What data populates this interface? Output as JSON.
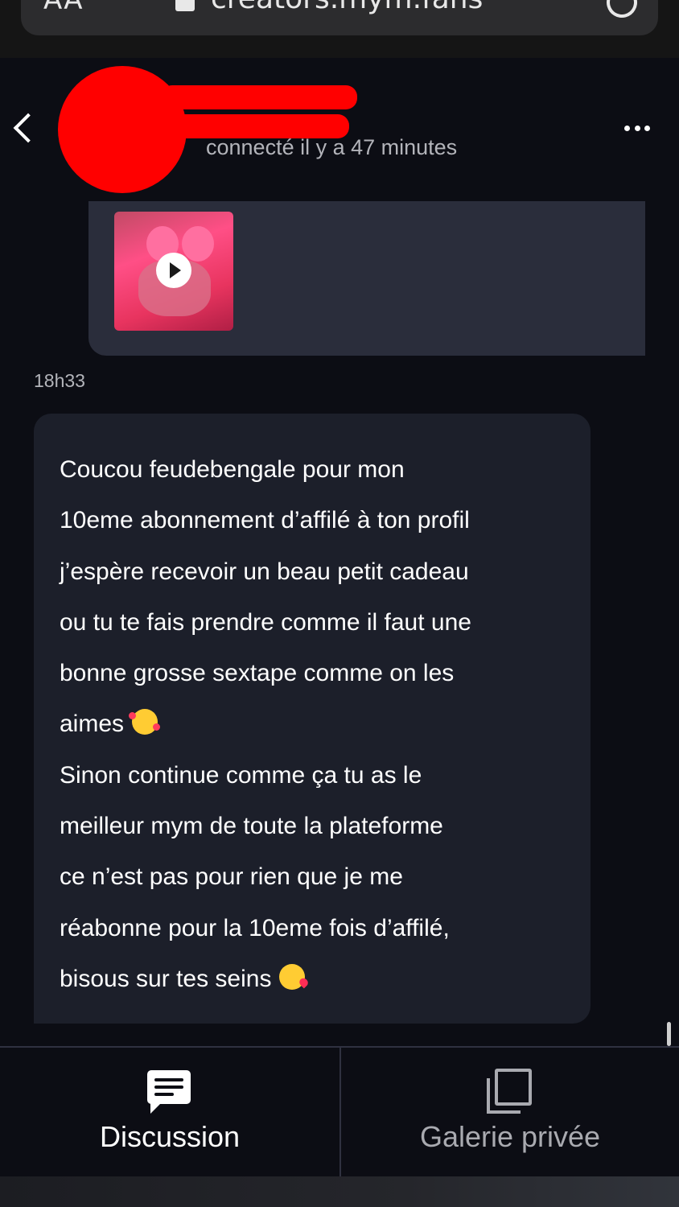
{
  "browser": {
    "text_size_label": "AA",
    "url": "creators.mym.fans"
  },
  "header": {
    "status": "connecté il y a 47 minutes"
  },
  "messages": {
    "media": {
      "type": "video"
    },
    "time": "18h33",
    "text_lines": [
      "Coucou feudebengale pour mon",
      "10eme abonnement d’affilé à ton profil",
      "j’espère recevoir un beau petit cadeau",
      "ou tu te fais prendre comme il faut une",
      "bonne grosse sextape comme on les",
      "aimes",
      "Sinon continue comme ça tu as le",
      "meilleur mym de toute la plateforme",
      "ce n’est pas pour rien que je me",
      "réabonne pour la 10eme fois d’affilé,",
      "bisous sur tes seins"
    ],
    "emojis": [
      "smiling-face-with-hearts",
      "face-blowing-a-kiss"
    ]
  },
  "tabs": [
    {
      "label": "Discussion",
      "icon": "chat-icon",
      "active": true
    },
    {
      "label": "Galerie privée",
      "icon": "gallery-icon",
      "active": false
    }
  ],
  "colors": {
    "background": "#0c0d14",
    "media_bubble": "#2a2d3b",
    "text_bubble": "#1c1f2a",
    "muted_text": "#b3b4ba",
    "redaction": "#ff0000"
  }
}
